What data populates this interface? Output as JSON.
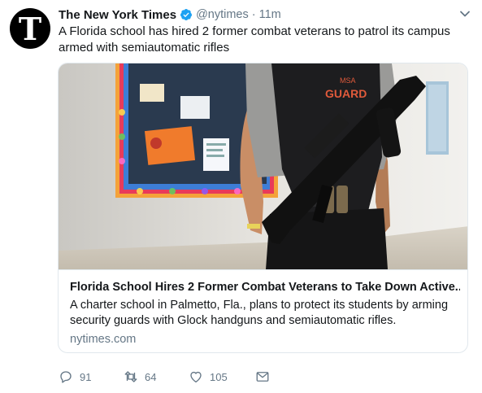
{
  "tweet": {
    "avatar_letter": "T",
    "name": "The New York Times",
    "handle": "@nytimes",
    "separator": "·",
    "time": "11m",
    "text": "A Florida school has hired 2 former combat veterans to patrol its campus armed with semiautomatic rifles"
  },
  "card": {
    "title": "Florida School Hires 2 Former Combat Veterans to Take Down Active...",
    "description": "A charter school in Palmetto, Fla., plans to protect its students by arming security guards with Glock handguns and semiautomatic rifles.",
    "domain": "nytimes.com",
    "image_text": {
      "vest_top": "MSA",
      "vest_main": "GUARD"
    }
  },
  "actions": {
    "replies": "91",
    "retweets": "64",
    "likes": "105"
  },
  "icons": {
    "verified": "verified-badge-icon",
    "caret": "chevron-down-icon",
    "reply": "reply-icon",
    "retweet": "retweet-icon",
    "like": "heart-icon",
    "dm": "envelope-icon"
  },
  "colors": {
    "verified_blue": "#1da1f2",
    "text": "#14171a",
    "muted": "#657786",
    "border": "#e1e8ed"
  }
}
